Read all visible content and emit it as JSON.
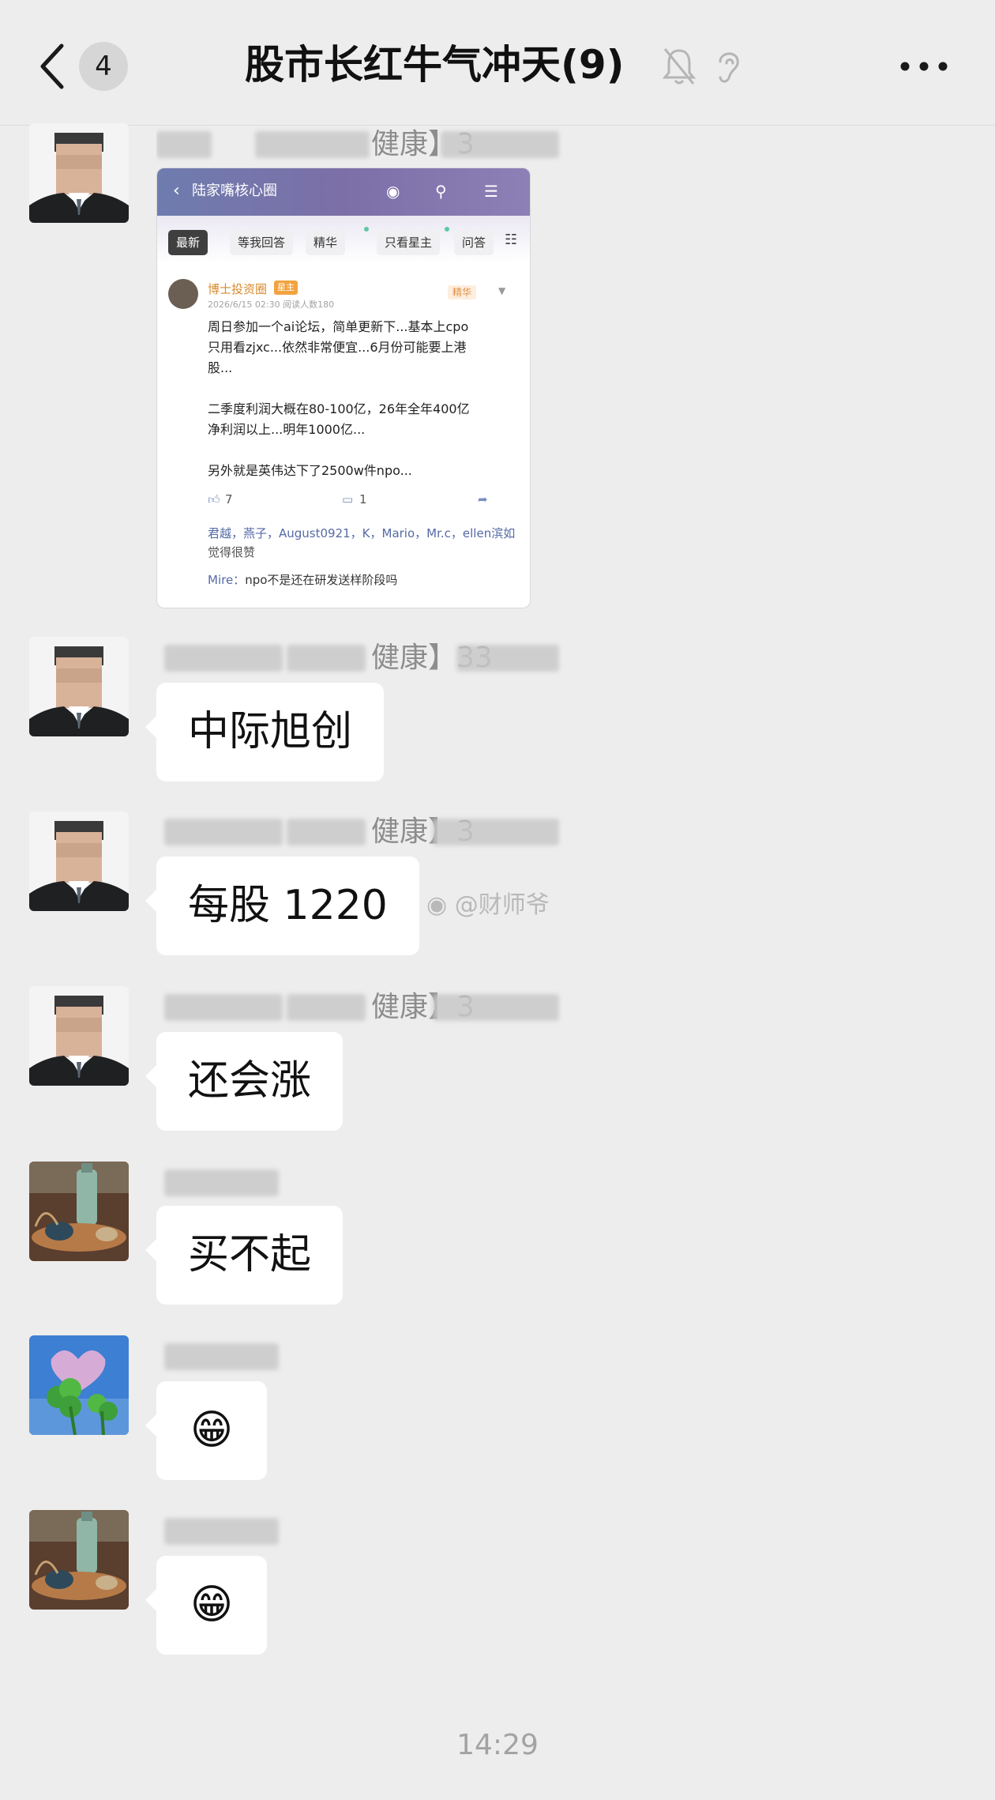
{
  "header": {
    "unread_count": "4",
    "title": "股市长红牛气冲天(9)"
  },
  "messages": [
    {
      "sender_visible": "健康】3",
      "image": {
        "top_title": "陆家嘴核心圈",
        "tabs": [
          "最新",
          "等我回答",
          "精华",
          "只看星主",
          "问答"
        ],
        "author": "博士投资圈",
        "author_tag": "星主",
        "meta": "2026/6/15 02:30    阅读人数180",
        "badge": "精华",
        "lines": [
          "周日参加一个ai论坛，简单更新下...基本上cpo",
          "只用看zjxc...依然非常便宜...6月份可能要上港",
          "股...",
          "二季度利润大概在80-100亿，26年全年400亿",
          "净利润以上...明年1000亿...",
          "另外就是英伟达下了2500w件npo..."
        ],
        "likes_count": "7",
        "comments_count": "1",
        "likes_names": "君越，燕子，August0921，K，Mario，Mr.c，ellen滨如",
        "likes_suffix": "觉得很赞",
        "comment_author": "Mire：",
        "comment_text": "npo不是还在研发送样阶段吗"
      }
    },
    {
      "sender_visible": "健康】33",
      "text": "中际旭创"
    },
    {
      "sender_visible": "健康】3",
      "text": "每股 1220"
    },
    {
      "sender_visible": "健康】3",
      "text": "还会涨"
    },
    {
      "sender_visible": "",
      "text": "买不起"
    },
    {
      "sender_visible": "",
      "emoji": "😁"
    },
    {
      "sender_visible": "",
      "emoji": "😁"
    }
  ],
  "watermark": "@财师爷",
  "timestamp": "14:29"
}
